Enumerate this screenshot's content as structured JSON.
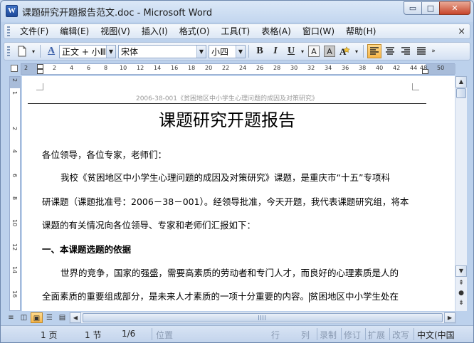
{
  "window": {
    "title": "课题研究开题报告范文.doc - Microsoft Word",
    "app_icon": "W",
    "min_label": "▭",
    "max_label": "□",
    "close_label": "✕"
  },
  "menu": {
    "items": [
      "文件(F)",
      "编辑(E)",
      "视图(V)",
      "插入(I)",
      "格式(O)",
      "工具(T)",
      "表格(A)",
      "窗口(W)",
      "帮助(H)"
    ],
    "close": "×"
  },
  "toolbar": {
    "style_value": "正文 + 小Ⅲ",
    "font_value": "宋体",
    "size_value": "小四",
    "bold": "B",
    "italic": "I",
    "underline": "U",
    "char_border": "A",
    "char_shading": "A",
    "align_left_active": true
  },
  "ruler": {
    "ticks": [
      "2",
      "2",
      "4",
      "6",
      "8",
      "10",
      "12",
      "14",
      "16",
      "18",
      "20",
      "22",
      "24",
      "26",
      "28",
      "30",
      "32",
      "34",
      "36",
      "38",
      "40",
      "42",
      "44",
      "48",
      "50"
    ],
    "vticks": [
      "2",
      "1",
      "2",
      "4",
      "6",
      "8",
      "10",
      "12",
      "14",
      "16"
    ]
  },
  "document": {
    "header": "2006-38-001《贫困地区中小学生心理问题的成因及对策研究》",
    "title": "课题研究开题报告",
    "paragraphs": [
      "各位领导，各位专家，老师们：",
      "我校《贫困地区中小学生心理问题的成因及对策研究》课题，是重庆市“十五”专项科",
      "研课题（课题批准号：2006－38－001）。经领导批准，今天开题，我代表课题研究组，将本",
      "课题的有关情况向各位领导、专家和老师们汇报如下：",
      "一、本课题选题的依据",
      "世界的竞争，国家的强盛，需要高素质的劳动者和专门人才，而良好的心理素质是人的",
      "全面素质的重要组成部分，是未来人才素质的一项十分重要的内容。",
      "贫困地区中小学生处在"
    ]
  },
  "status": {
    "page": "1 页",
    "section": "1 节",
    "page_of": "1/6",
    "position": "位置",
    "line": "行",
    "column": "列",
    "record": "录制",
    "revise": "修订",
    "extend": "扩展",
    "overtype": "改写",
    "language": "中文(中国"
  }
}
